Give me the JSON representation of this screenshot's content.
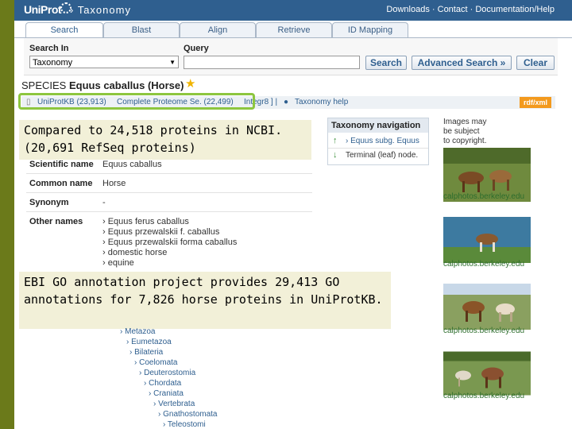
{
  "header": {
    "logo": "UniProt",
    "breadcrumb": "› Taxonomy",
    "nav": [
      "Downloads",
      "Contact",
      "Documentation/Help"
    ]
  },
  "tabs": [
    "Search",
    "Blast",
    "Align",
    "Retrieve",
    "ID Mapping"
  ],
  "search": {
    "search_in_label": "Search In",
    "query_label": "Query",
    "selected": "Taxonomy",
    "query_value": "",
    "buttons": [
      "Search",
      "Advanced Search »",
      "Clear"
    ]
  },
  "species": {
    "prefix": "SPECIES",
    "name": "Equus caballus (Horse)"
  },
  "linkbar": {
    "uniprot": "UniProtKB (23,913)",
    "proteome": "Complete Proteome Se. (22,499)",
    "integr": "Integr8 ] |",
    "help": "Taxonomy help",
    "rdf": "rdf/xml"
  },
  "note1": [
    "Compared to 24,518 proteins in NCBI.",
    "(20,691 RefSeq proteins)"
  ],
  "note2": [
    "EBI GO annotation project provides 29,413 GO",
    "annotations for 7,826 horse proteins in UniProtKB."
  ],
  "info": [
    {
      "label": "Scientific name",
      "value": "Equus caballus"
    },
    {
      "label": "Common name",
      "value": "Horse"
    },
    {
      "label": "Synonym",
      "value": "-"
    }
  ],
  "other_names_label": "Other names",
  "other_names": [
    "› Equus ferus caballus",
    "› Equus przewalskii f. caballus",
    "› Equus przewalskii forma caballus",
    "› domestic horse",
    "› equine"
  ],
  "taxnav": {
    "title": "Taxonomy navigation",
    "up": "› Equus subg. Equus",
    "down": "Terminal (leaf) node."
  },
  "image_note": [
    "Images may",
    "be subject",
    "to copyright."
  ],
  "photo_caption": "calphotos.berkeley.edu",
  "lineage": [
    "› Metazoa",
    "› Eumetazoa",
    "› Bilateria",
    "› Coelomata",
    "› Deuterostomia",
    "› Chordata",
    "› Craniata",
    "› Vertebrata",
    "› Gnathostomata",
    "› Teleostomi"
  ]
}
